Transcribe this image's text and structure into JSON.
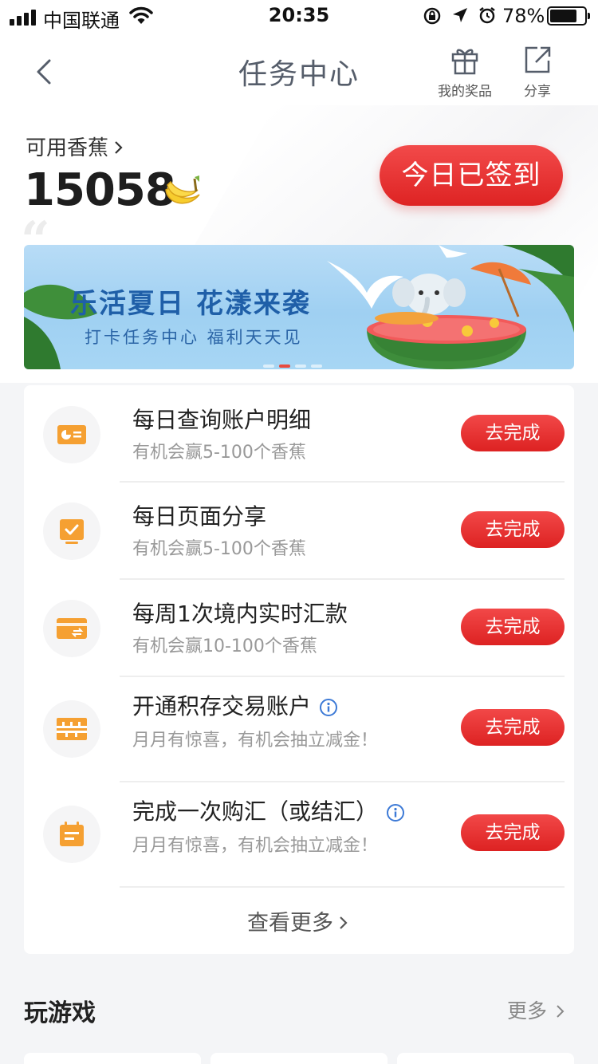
{
  "status_bar": {
    "carrier": "中国联通",
    "time": "20:35",
    "battery": "78%",
    "battery_level": 0.78
  },
  "nav": {
    "title": "任务中心",
    "gift_label": "我的奖品",
    "share_label": "分享"
  },
  "points": {
    "link_label": "可用香蕉",
    "value": "15058",
    "checkin_label": "今日已签到"
  },
  "banner": {
    "title": "乐活夏日  花漾来袭",
    "subtitle": "打卡任务中心 福利天天见",
    "active_slide": 2,
    "slide_count": 4
  },
  "tasks": [
    {
      "title": "每日查询账户明细",
      "desc": "有机会赢5-100个香蕉",
      "button": "去完成",
      "icon": "account-detail-icon",
      "has_info": false
    },
    {
      "title": "每日页面分享",
      "desc": "有机会赢5-100个香蕉",
      "button": "去完成",
      "icon": "share-page-icon",
      "has_info": false
    },
    {
      "title": "每周1次境内实时汇款",
      "desc": "有机会赢10-100个香蕉",
      "button": "去完成",
      "icon": "transfer-card-icon",
      "has_info": false
    },
    {
      "title": "开通积存交易账户",
      "desc": "月月有惊喜，有机会抽立减金！",
      "button": "去完成",
      "icon": "gold-bar-icon",
      "has_info": true
    },
    {
      "title": "完成一次购汇（或结汇）",
      "desc": "月月有惊喜，有机会抽立减金！",
      "button": "去完成",
      "icon": "calendar-icon",
      "has_info": true
    }
  ],
  "see_more": "查看更多",
  "games": {
    "title": "玩游戏",
    "more": "更多"
  },
  "colors": {
    "accent_red": "#e42c2c",
    "icon_orange": "#f5a032",
    "banner_sky": "#a9d6f3"
  }
}
